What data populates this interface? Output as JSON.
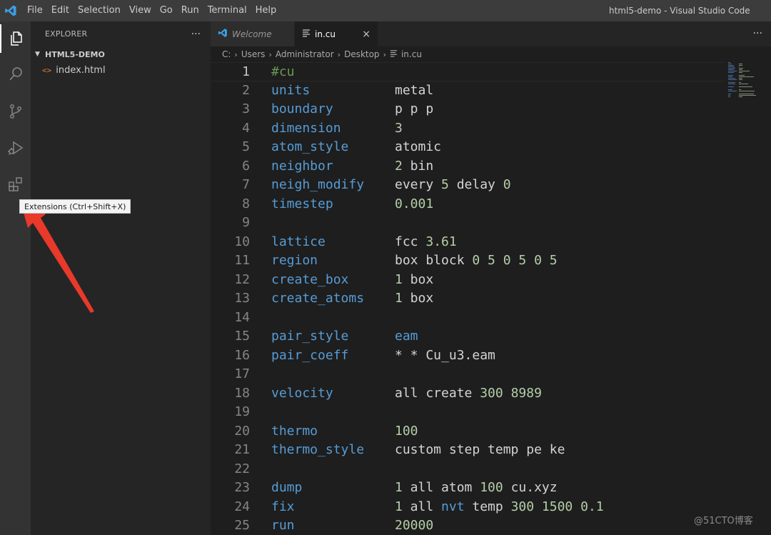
{
  "titlebar": {
    "menu": [
      "File",
      "Edit",
      "Selection",
      "View",
      "Go",
      "Run",
      "Terminal",
      "Help"
    ],
    "window_title": "html5-demo - Visual Studio Code"
  },
  "activity_bar": {
    "icons": [
      "explorer-icon",
      "search-icon",
      "source-control-icon",
      "run-debug-icon",
      "extensions-icon"
    ],
    "tooltip": "Extensions (Ctrl+Shift+X)"
  },
  "sidebar": {
    "title": "EXPLORER",
    "more": "···",
    "folder": "HTML5-DEMO",
    "files": [
      {
        "name": "index.html",
        "icon": "<>"
      }
    ]
  },
  "tabs": [
    {
      "label": "Welcome",
      "active": false
    },
    {
      "label": "in.cu",
      "active": true,
      "close": "×"
    }
  ],
  "tabs_more": "···",
  "breadcrumb": [
    "C:",
    "Users",
    "Administrator",
    "Desktop",
    "in.cu"
  ],
  "editor": {
    "active_line": 1,
    "lines": [
      {
        "n": "1",
        "kw": "#cu",
        "comment": true,
        "val": []
      },
      {
        "n": "2",
        "kw": "units",
        "val": [
          [
            "metal",
            "t"
          ]
        ]
      },
      {
        "n": "3",
        "kw": "boundary",
        "val": [
          [
            "p p p",
            "t"
          ]
        ]
      },
      {
        "n": "4",
        "kw": "dimension",
        "val": [
          [
            "3",
            "n"
          ]
        ]
      },
      {
        "n": "5",
        "kw": "atom_style",
        "val": [
          [
            "atomic",
            "t"
          ]
        ]
      },
      {
        "n": "6",
        "kw": "neighbor",
        "val": [
          [
            "2",
            "n"
          ],
          [
            " bin",
            "t"
          ]
        ]
      },
      {
        "n": "7",
        "kw": "neigh_modify",
        "val": [
          [
            "every ",
            "t"
          ],
          [
            "5",
            "n"
          ],
          [
            " delay ",
            "t"
          ],
          [
            "0",
            "n"
          ]
        ]
      },
      {
        "n": "8",
        "kw": "timestep",
        "val": [
          [
            "0.001",
            "n"
          ]
        ]
      },
      {
        "n": "9",
        "kw": "",
        "val": []
      },
      {
        "n": "10",
        "kw": "lattice",
        "val": [
          [
            "fcc ",
            "t"
          ],
          [
            "3.61",
            "n"
          ]
        ]
      },
      {
        "n": "11",
        "kw": "region",
        "val": [
          [
            "box block ",
            "t"
          ],
          [
            "0 5 0 5 0 5",
            "n"
          ]
        ]
      },
      {
        "n": "12",
        "kw": "create_box",
        "val": [
          [
            "1",
            "n"
          ],
          [
            " box",
            "t"
          ]
        ]
      },
      {
        "n": "13",
        "kw": "create_atoms",
        "val": [
          [
            "1",
            "n"
          ],
          [
            " box",
            "t"
          ]
        ]
      },
      {
        "n": "14",
        "kw": "",
        "val": []
      },
      {
        "n": "15",
        "kw": "pair_style",
        "val": [
          [
            "eam",
            "k"
          ]
        ]
      },
      {
        "n": "16",
        "kw": "pair_coeff",
        "val": [
          [
            "* * Cu_u3.eam",
            "t"
          ]
        ]
      },
      {
        "n": "17",
        "kw": "",
        "val": []
      },
      {
        "n": "18",
        "kw": "velocity",
        "val": [
          [
            "all create ",
            "t"
          ],
          [
            "300 8989",
            "n"
          ]
        ]
      },
      {
        "n": "19",
        "kw": "",
        "val": []
      },
      {
        "n": "20",
        "kw": "thermo",
        "val": [
          [
            "100",
            "n"
          ]
        ]
      },
      {
        "n": "21",
        "kw": "thermo_style",
        "val": [
          [
            "custom step temp pe ke",
            "t"
          ]
        ]
      },
      {
        "n": "22",
        "kw": "",
        "val": []
      },
      {
        "n": "23",
        "kw": "dump",
        "val": [
          [
            "1",
            "n"
          ],
          [
            " all atom ",
            "t"
          ],
          [
            "100",
            "n"
          ],
          [
            " cu.xyz",
            "t"
          ]
        ]
      },
      {
        "n": "24",
        "kw": "fix",
        "val": [
          [
            "1",
            "n"
          ],
          [
            " all ",
            "t"
          ],
          [
            "nvt",
            "k"
          ],
          [
            " temp ",
            "t"
          ],
          [
            "300 1500 0.1",
            "n"
          ]
        ]
      },
      {
        "n": "25",
        "kw": "run",
        "val": [
          [
            "20000",
            "n"
          ]
        ]
      }
    ]
  },
  "colors": {
    "keyword": "#569cd6",
    "number": "#b5cea8",
    "text": "#d4d4d4",
    "comment": "#6a9955",
    "arrow": "#e8392b"
  },
  "watermark": "@51CTO博客"
}
